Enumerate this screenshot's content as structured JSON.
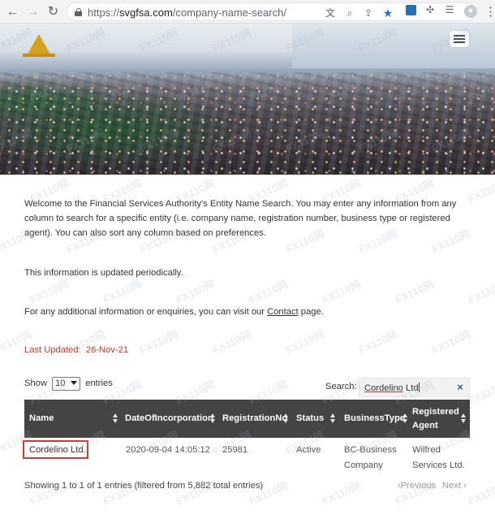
{
  "browser": {
    "url_protocol": "https://",
    "url_host": "svgfsa.com",
    "url_path": "/company-name-search/",
    "back_icon": "arrow-left-icon",
    "forward_icon": "arrow-right-icon",
    "reload_icon": "reload-icon",
    "star_color": "#1a73e8"
  },
  "hero": {
    "logo_icon": "fsa-triangle-logo",
    "menu_icon": "hamburger-menu-icon"
  },
  "content": {
    "intro": "Welcome to the Financial Services Authority's Entity Name Search. You may enter any information from any column to search for a specific entity (i.e. company name, registration number, business type or registered agent). You can also sort any column based on preferences.",
    "updated_note": "This information is updated periodically.",
    "enquiry_prefix": "For any additional information or enquiries, you can visit our ",
    "enquiry_link": "Contact",
    "enquiry_suffix": " page.",
    "last_updated_label": "Last Updated:",
    "last_updated_value": "26-Nov-21"
  },
  "table_controls": {
    "show_label": "Show",
    "entries_value": "10",
    "entries_label": "entries",
    "search_label": "Search:",
    "search_value_word": "Cordelino",
    "search_value_rest": " Ltd",
    "search_clear": "×"
  },
  "table": {
    "headers": [
      "Name",
      "DateOfIncorporation",
      "RegistrationNo",
      "Status",
      "BusinessType",
      "Registered Agent"
    ],
    "rows": [
      {
        "name": "Cordelino Ltd.",
        "date": "2020-09-04 14:05:12",
        "reg_no": "25981",
        "status": "Active",
        "business_type": "BC-Business Company",
        "agent": "Wilfred Services Ltd."
      }
    ]
  },
  "footer": {
    "info": "Showing 1 to 1 of 1 entries (filtered from 5,882 total entries)",
    "previous": "Previous",
    "next": "Next"
  },
  "watermark_text": "FX110网"
}
